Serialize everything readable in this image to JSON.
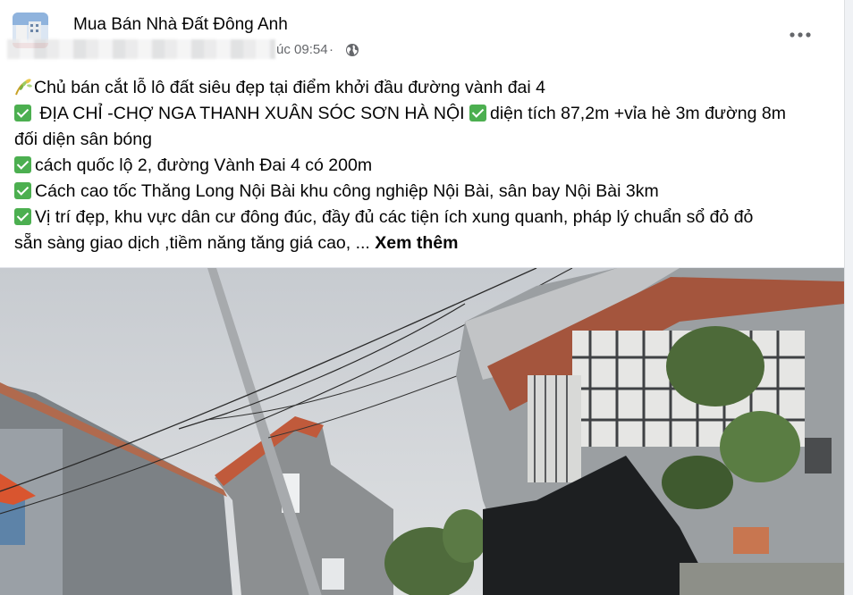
{
  "post": {
    "group_name": "Mua Bán Nhà Đất Đông Anh",
    "timestamp": "úc 09:54",
    "separator": "·",
    "privacy_icon": "globe-icon",
    "more_icon": "more-horizontal-icon",
    "lines": [
      {
        "icon": "sprout-icon",
        "text": "Chủ bán cắt lỗ lô đất siêu đẹp tại điểm khởi đầu đường vành đai 4"
      },
      {
        "icon": "check-icon",
        "text": " ĐỊA CHỈ -CHỢ NGA THANH XUÂN SÓC SƠN HÀ NỘI ",
        "text2": "diện tích 87,2m +vỉa hè 3m đường 8m"
      },
      {
        "icon": "",
        "text": "đối diện sân bóng"
      },
      {
        "icon": "check-icon",
        "text": "cách quốc lộ 2, đường Vành Đai 4 có 200m"
      },
      {
        "icon": "check-icon",
        "text": "Cách cao tốc Thăng Long Nội Bài khu công nghiệp Nội Bài, sân bay Nội Bài 3km"
      },
      {
        "icon": "check-icon",
        "text": "Vị trí đẹp, khu vực dân cư đông đúc, đầy đủ các tiện ích xung quanh, pháp lý chuẩn sổ đỏ đỏ"
      },
      {
        "icon": "",
        "text": "sẵn sàng giao dịch ,tiềm năng tăng giá cao, ... "
      }
    ],
    "see_more": "Xem thêm"
  },
  "colors": {
    "secondary_text": "#65676b",
    "check_green": "#4caf50",
    "card_bg": "#ffffff",
    "page_bg": "#f0f2f5"
  }
}
